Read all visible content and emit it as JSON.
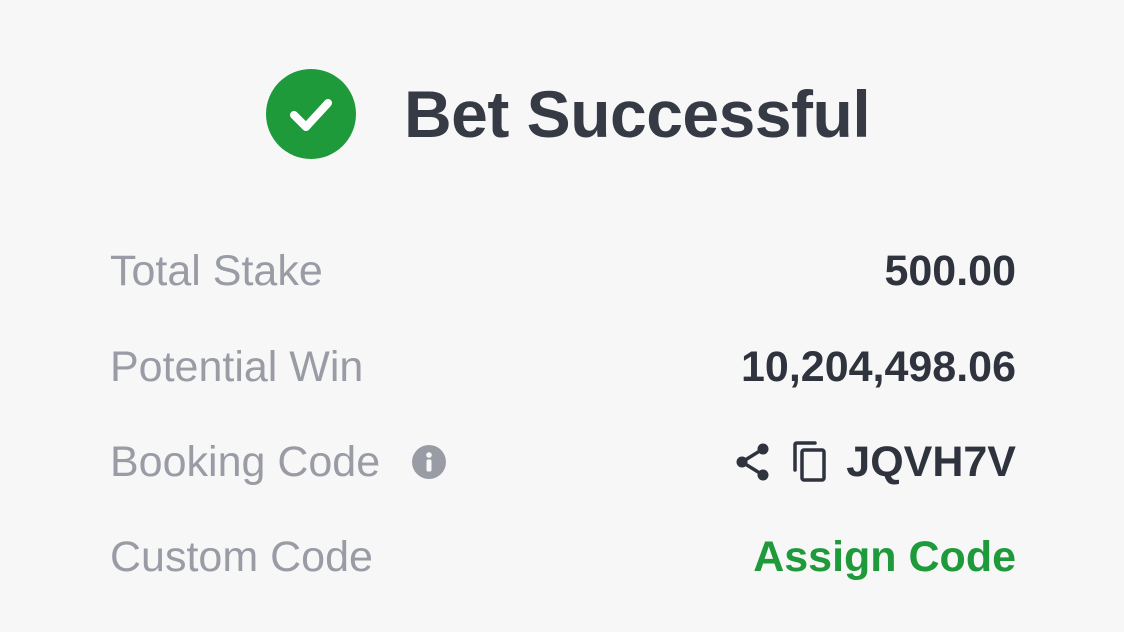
{
  "header": {
    "title": "Bet Successful",
    "icon": "check-circle-icon",
    "accent_color": "#1e9a3a"
  },
  "rows": {
    "total_stake": {
      "label": "Total Stake",
      "value": "500.00"
    },
    "potential_win": {
      "label": "Potential Win",
      "value": "10,204,498.06"
    },
    "booking_code": {
      "label": "Booking Code",
      "info_icon": "info-icon",
      "share_icon": "share-icon",
      "copy_icon": "copy-icon",
      "value": "JQVH7V"
    },
    "custom_code": {
      "label": "Custom Code",
      "action_label": "Assign Code"
    }
  }
}
